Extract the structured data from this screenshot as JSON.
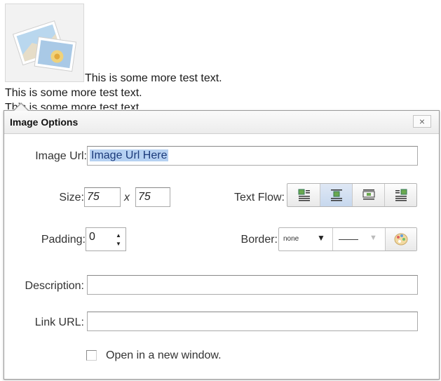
{
  "editor": {
    "line1": "This is some more test text.",
    "line2": "This is some more test text.",
    "line3": "This is some more test text."
  },
  "dialog": {
    "title": "Image Options",
    "close_label": "×",
    "image_url": {
      "label": "Image Url:",
      "value": "Image Url Here"
    },
    "size": {
      "label": "Size:",
      "width": "75",
      "separator": "x",
      "height": "75"
    },
    "text_flow": {
      "label": "Text Flow:",
      "options": [
        {
          "icon": "flow-left-icon",
          "active": false
        },
        {
          "icon": "flow-inline-icon",
          "active": true
        },
        {
          "icon": "flow-center-icon",
          "active": false
        },
        {
          "icon": "flow-right-icon",
          "active": false
        }
      ]
    },
    "padding": {
      "label": "Padding:",
      "value": "0"
    },
    "border": {
      "label": "Border:",
      "style_value": "none",
      "line_value": "——",
      "color_icon": "palette-icon"
    },
    "description": {
      "label": "Description:",
      "value": ""
    },
    "link_url": {
      "label": "Link URL:",
      "value": ""
    },
    "open_new_window": {
      "label": "Open in a new window.",
      "checked": false
    }
  }
}
